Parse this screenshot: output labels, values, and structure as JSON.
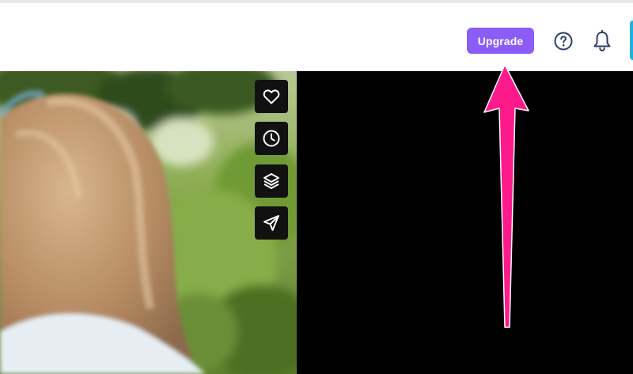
{
  "header": {
    "upgrade_label": "Upgrade",
    "accent_color": "#8b5cf6",
    "icons": [
      "help-icon",
      "bell-icon"
    ]
  },
  "photo_toolbar": {
    "icons": [
      "heart-icon",
      "clock-icon",
      "layers-icon",
      "send-icon"
    ]
  },
  "annotation": {
    "arrow_color": "#ff1a8c"
  }
}
